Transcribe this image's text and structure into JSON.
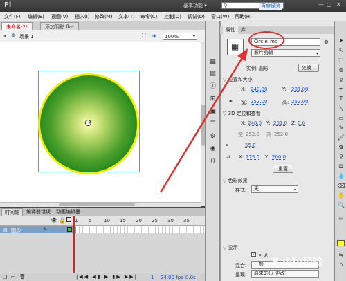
{
  "app": {
    "logo": "Fl",
    "workspace": "基本功能 ▾",
    "search_placeholder": "",
    "search_badge": "百度经验"
  },
  "menu": [
    "文件(F)",
    "编辑(E)",
    "视图(V)",
    "插入(I)",
    "修改(M)",
    "文本(T)",
    "命令(C)",
    "控制(O)",
    "调试(D)",
    "窗口(W)",
    "帮助(H)"
  ],
  "doc_tabs": [
    {
      "label": "未命名-2*"
    },
    {
      "label": "添加阴影.fla*"
    }
  ],
  "editbar": {
    "scene": "场景 1",
    "zoom": "100%"
  },
  "timeline": {
    "tabs": [
      "时间轴",
      "编译器错误",
      "动画编辑器"
    ],
    "frame_numbers": [
      "1",
      "5",
      "10",
      "15",
      "20",
      "25",
      "30",
      "35"
    ],
    "layer_name": "图形",
    "footer": {
      "fps": "24.00 fps",
      "time": "0.0s",
      "frame": "1"
    }
  },
  "properties": {
    "tabs": [
      "属性",
      "库"
    ],
    "instance_name": "Circle_mc",
    "instance_type": "影片剪辑",
    "instance_of_label": "实例:",
    "instance_of": "圆形",
    "swap_button": "交换...",
    "position_size": {
      "title": "位置和大小",
      "x_label": "X:",
      "x": "248.00",
      "y_label": "Y:",
      "y": "201.00",
      "w_label": "宽:",
      "w": "252.00",
      "h_label": "高:",
      "h": "252.00"
    },
    "three_d": {
      "title": "3D 定位和查看",
      "x_label": "X:",
      "x": "248.0",
      "y_label": "Y:",
      "y": "201.0",
      "z_label": "Z:",
      "z": "0.0",
      "w_label": "宽:",
      "w": "252.0",
      "h_label": "高:",
      "h": "252.0",
      "perspective": "55.0",
      "vx_label": "X:",
      "vx": "275.0",
      "vy_label": "Y:",
      "vy": "200.0",
      "reset_button": "重置"
    },
    "color_effect": {
      "title": "色彩效果",
      "style_label": "样式:",
      "style": "无"
    },
    "display": {
      "title": "显示",
      "visible_label": "可见",
      "blend_label": "混合:",
      "blend": "一般",
      "render_label": "呈现:",
      "render": "原来的(无更改)"
    }
  },
  "watermark": "Baidu经验",
  "colors": {
    "accent_red": "#e03030",
    "circle_stroke": "#f0f000",
    "circle_center": "#ffffb0",
    "circle_edge": "#127517",
    "value_blue": "#1a4fd0"
  }
}
